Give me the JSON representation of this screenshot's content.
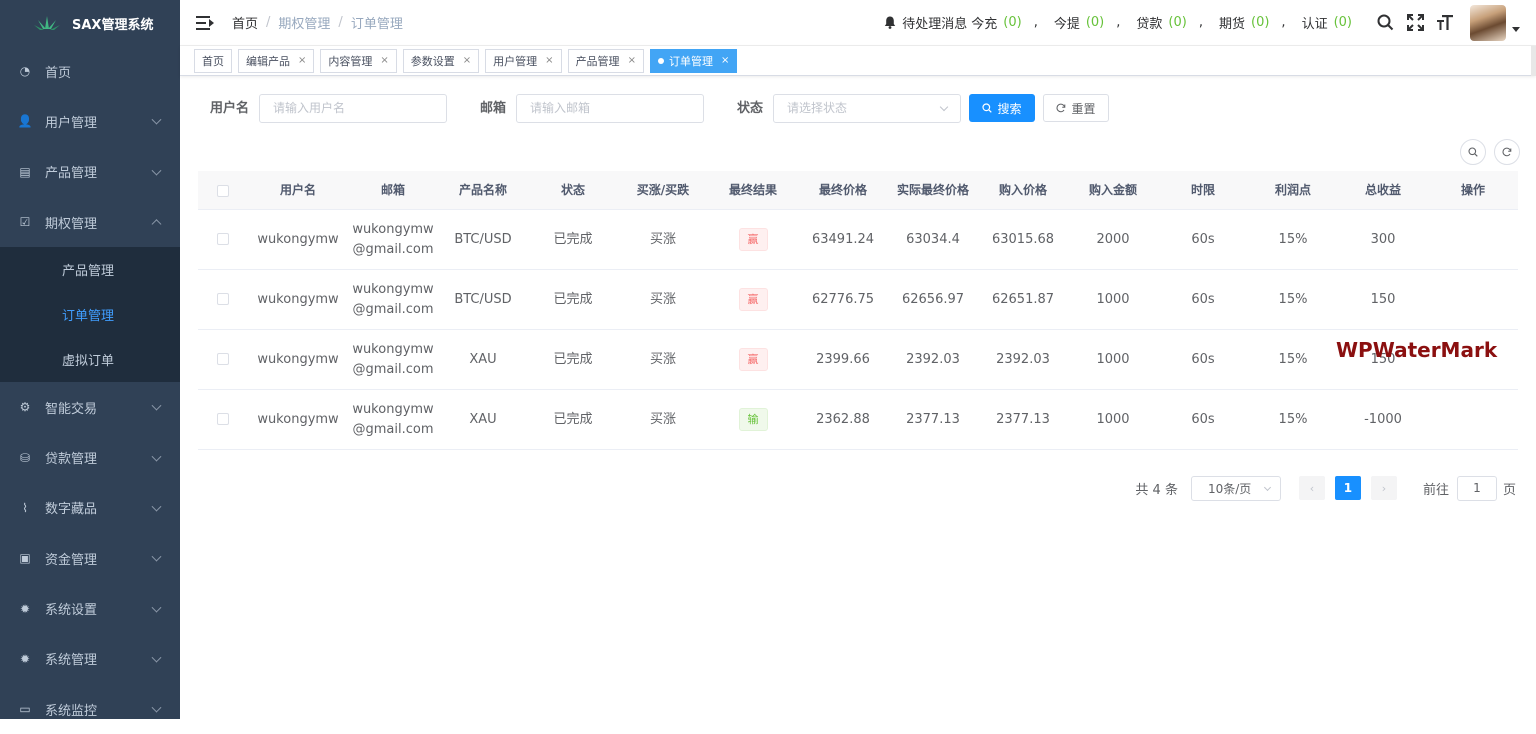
{
  "app": {
    "title": "SAX管理系统"
  },
  "sidebar": {
    "items": [
      {
        "label": "首页",
        "icon": "dashboard-icon",
        "has_children": false
      },
      {
        "label": "用户管理",
        "icon": "users-icon",
        "has_children": true
      },
      {
        "label": "产品管理",
        "icon": "document-icon",
        "has_children": true
      },
      {
        "label": "期权管理",
        "icon": "edit-icon",
        "has_children": true,
        "expanded": true,
        "children": [
          {
            "label": "产品管理"
          },
          {
            "label": "订单管理",
            "active": true
          },
          {
            "label": "虚拟订单"
          }
        ]
      },
      {
        "label": "智能交易",
        "icon": "gear-icon",
        "has_children": true
      },
      {
        "label": "贷款管理",
        "icon": "database-icon",
        "has_children": true
      },
      {
        "label": "数字藏品",
        "icon": "chart-icon",
        "has_children": true
      },
      {
        "label": "资金管理",
        "icon": "money-icon",
        "has_children": true
      },
      {
        "label": "系统设置",
        "icon": "settings-icon",
        "has_children": true
      },
      {
        "label": "系统管理",
        "icon": "settings-icon",
        "has_children": true
      },
      {
        "label": "系统监控",
        "icon": "monitor-icon",
        "has_children": true
      }
    ],
    "colors": {
      "bg": "#304156",
      "submenu_bg": "#1f2d3d",
      "active": "#409eff"
    }
  },
  "navbar": {
    "breadcrumb": [
      "首页",
      "期权管理",
      "订单管理"
    ],
    "notice": {
      "prefix": "待处理消息",
      "items": [
        {
          "label": "今充",
          "count": "(0)"
        },
        {
          "label": "今提",
          "count": "(0)"
        },
        {
          "label": "贷款",
          "count": "(0)"
        },
        {
          "label": "期货",
          "count": "(0)"
        },
        {
          "label": "认证",
          "count": "(0)"
        }
      ],
      "separator": ","
    }
  },
  "tags": [
    {
      "label": "首页",
      "closable": false
    },
    {
      "label": "编辑产品",
      "closable": true
    },
    {
      "label": "内容管理",
      "closable": true
    },
    {
      "label": "参数设置",
      "closable": true
    },
    {
      "label": "用户管理",
      "closable": true
    },
    {
      "label": "产品管理",
      "closable": true
    },
    {
      "label": "订单管理",
      "closable": true,
      "active": true
    }
  ],
  "search": {
    "username_label": "用户名",
    "username_placeholder": "请输入用户名",
    "email_label": "邮箱",
    "email_placeholder": "请输入邮箱",
    "status_label": "状态",
    "status_placeholder": "请选择状态",
    "search_button": "搜索",
    "reset_button": "重置"
  },
  "table": {
    "columns": [
      "用户名",
      "邮箱",
      "产品名称",
      "状态",
      "买涨/买跌",
      "最终结果",
      "最终价格",
      "实际最终价格",
      "购入价格",
      "购入金额",
      "时限",
      "利润点",
      "总收益",
      "操作"
    ],
    "rows": [
      {
        "username": "wukongymw",
        "email_1": "wukongymw",
        "email_2": "@gmail.com",
        "product": "BTC/USD",
        "status": "已完成",
        "direction": "买涨",
        "result": "赢",
        "result_type": "win",
        "final_price": "63491.24",
        "actual_final_price": "63034.4",
        "buy_price": "63015.68",
        "amount": "2000",
        "duration": "60s",
        "profit_point": "15%",
        "total_profit": "300"
      },
      {
        "username": "wukongymw",
        "email_1": "wukongymw",
        "email_2": "@gmail.com",
        "product": "BTC/USD",
        "status": "已完成",
        "direction": "买涨",
        "result": "赢",
        "result_type": "win",
        "final_price": "62776.75",
        "actual_final_price": "62656.97",
        "buy_price": "62651.87",
        "amount": "1000",
        "duration": "60s",
        "profit_point": "15%",
        "total_profit": "150"
      },
      {
        "username": "wukongymw",
        "email_1": "wukongymw",
        "email_2": "@gmail.com",
        "product": "XAU",
        "status": "已完成",
        "direction": "买涨",
        "result": "赢",
        "result_type": "win",
        "final_price": "2399.66",
        "actual_final_price": "2392.03",
        "buy_price": "2392.03",
        "amount": "1000",
        "duration": "60s",
        "profit_point": "15%",
        "total_profit": "150"
      },
      {
        "username": "wukongymw",
        "email_1": "wukongymw",
        "email_2": "@gmail.com",
        "product": "XAU",
        "status": "已完成",
        "direction": "买涨",
        "result": "输",
        "result_type": "lose",
        "final_price": "2362.88",
        "actual_final_price": "2377.13",
        "buy_price": "2377.13",
        "amount": "1000",
        "duration": "60s",
        "profit_point": "15%",
        "total_profit": "-1000"
      }
    ]
  },
  "pagination": {
    "total_text": "共 4 条",
    "page_size": "10条/页",
    "current_page": "1",
    "goto_prefix": "前往",
    "goto_value": "1",
    "goto_suffix": "页"
  },
  "watermark": "WPWaterMark"
}
